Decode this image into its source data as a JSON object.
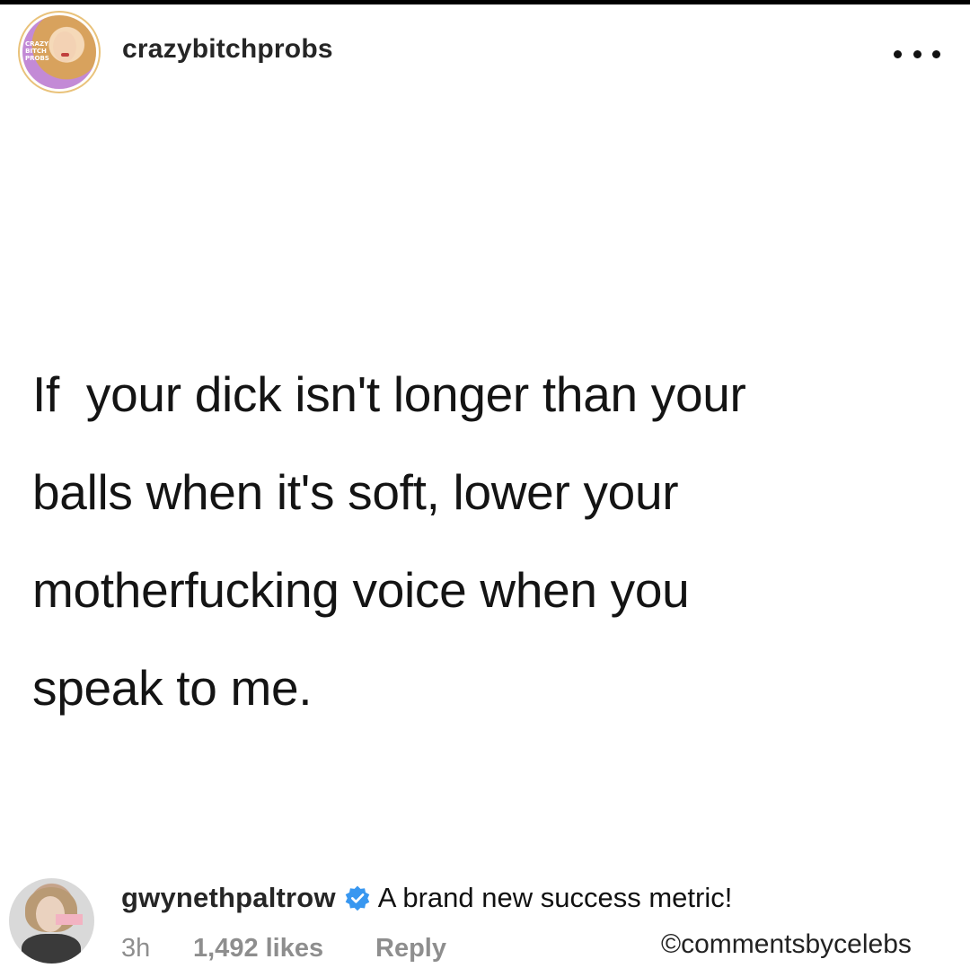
{
  "post": {
    "username": "crazybitchprobs",
    "avatar_badge": "CRAZY BITCH PROBS",
    "quote_lines": [
      "If  your dick isn't longer than your",
      "balls when it's soft, lower your",
      "motherfucking voice when you",
      "speak to me."
    ],
    "more_icon": "more-horizontal-icon"
  },
  "comment": {
    "username": "gwynethpaltrow",
    "verified_icon": "verified-badge-icon",
    "text": "A brand new success metric!",
    "time": "3h",
    "likes": "1,492 likes",
    "reply_label": "Reply"
  },
  "watermark": "©commentsbycelebs",
  "colors": {
    "verified_blue": "#3897f0",
    "meta_gray": "#8e8e8e",
    "text_dark": "#262626"
  }
}
